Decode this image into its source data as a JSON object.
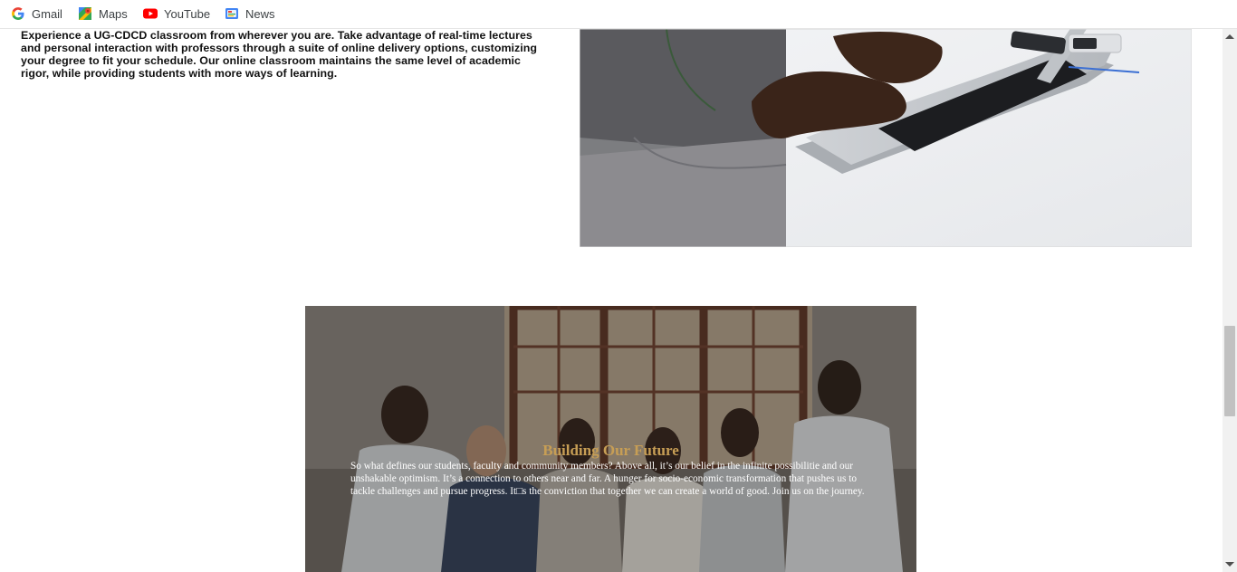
{
  "bookmarks": [
    {
      "label": "Gmail",
      "icon": "google-icon"
    },
    {
      "label": "Maps",
      "icon": "maps-icon"
    },
    {
      "label": "YouTube",
      "icon": "youtube-icon"
    },
    {
      "label": "News",
      "icon": "news-icon"
    }
  ],
  "intro": {
    "p1": "E",
    "p2": "xperience a ",
    "p3": "UG-CDCD",
    "p4": " classroom from wherever you are. Take advantage of real-time lectures and personal interaction with professors through a suite of online delivery options, customizing your degree to fit your schedule. ",
    "p5": "O",
    "p6": "ur online classroom maintains the same level of academic rigor, while providing students with more ways of learning."
  },
  "future": {
    "title": "Building Our Future",
    "body": "So what defines our students, faculty and community members? Above all, it’s our belief in the infinite possibilitie and our unshakable optimism. It’s a connection to others near and far. A hunger for socio-economic transformation that pushes us to tackle challenges and pursue progress. It□s the conviction that together we can create a world of good. Join us on the journey."
  },
  "colors": {
    "accent_gold": "#c79e55"
  }
}
